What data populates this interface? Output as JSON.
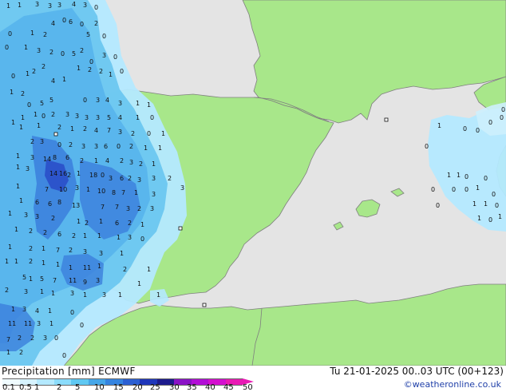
{
  "header": {
    "product": "Precipitation [mm]",
    "model": "ECMWF",
    "datetime": "Tu 21-01-2025 00..03 UTC (00+123)",
    "credit": "©weatheronline.co.uk"
  },
  "legend": {
    "ticks": [
      "0.1",
      "0.5",
      "1",
      "2",
      "5",
      "10",
      "15",
      "20",
      "25",
      "30",
      "35",
      "40",
      "45",
      "50"
    ],
    "colors": [
      "#f0fbff",
      "#d6f3ff",
      "#b4e9ff",
      "#8bdcfb",
      "#5fc8f2",
      "#45a6e8",
      "#3584e0",
      "#2b5fd3",
      "#1f36ba",
      "#1c1a8c",
      "#8a12c6",
      "#b20ed6",
      "#d40fcf",
      "#e91ab4"
    ]
  },
  "colors": {
    "sea": "#e4e4e4",
    "land": "#a8e78a",
    "border": "#7f7f7f",
    "precip_light": "#b4e9ff",
    "precip_mid": "#6cc7f0",
    "precip_heavy": "#3b7fdc",
    "precip_core": "#2a4fc9"
  },
  "map": {
    "labels": [
      [
        "1",
        8,
        10
      ],
      [
        "1",
        22,
        9
      ],
      [
        "3",
        44,
        8
      ],
      [
        "3",
        60,
        10
      ],
      [
        "3",
        72,
        9
      ],
      [
        "4",
        90,
        8
      ],
      [
        "3",
        104,
        9
      ],
      [
        "0",
        118,
        12
      ],
      [
        "0",
        10,
        45
      ],
      [
        "1",
        38,
        44
      ],
      [
        "2",
        54,
        46
      ],
      [
        "4",
        64,
        32
      ],
      [
        "0",
        78,
        28
      ],
      [
        "6",
        86,
        30
      ],
      [
        "0",
        100,
        33
      ],
      [
        "5",
        108,
        46
      ],
      [
        "2",
        118,
        32
      ],
      [
        "0",
        128,
        48
      ],
      [
        "0",
        6,
        62
      ],
      [
        "1",
        30,
        62
      ],
      [
        "3",
        46,
        66
      ],
      [
        "2",
        62,
        68
      ],
      [
        "0",
        76,
        70
      ],
      [
        "5",
        90,
        70
      ],
      [
        "2",
        100,
        66
      ],
      [
        "0",
        112,
        80
      ],
      [
        "3",
        128,
        72
      ],
      [
        "0",
        142,
        74
      ],
      [
        "0",
        14,
        98
      ],
      [
        "1",
        32,
        95
      ],
      [
        "2",
        40,
        92
      ],
      [
        "2",
        52,
        86
      ],
      [
        "4",
        64,
        104
      ],
      [
        "1",
        78,
        102
      ],
      [
        "1",
        96,
        88
      ],
      [
        "2",
        110,
        90
      ],
      [
        "2",
        124,
        92
      ],
      [
        "1",
        136,
        96
      ],
      [
        "0",
        150,
        92
      ],
      [
        "1",
        12,
        118
      ],
      [
        "2",
        26,
        120
      ],
      [
        "0",
        34,
        134
      ],
      [
        "5",
        50,
        132
      ],
      [
        "5",
        62,
        128
      ],
      [
        "0",
        104,
        128
      ],
      [
        "3",
        120,
        128
      ],
      [
        "4",
        132,
        128
      ],
      [
        "3",
        148,
        132
      ],
      [
        "1",
        170,
        132
      ],
      [
        "1",
        184,
        134
      ],
      [
        "1",
        14,
        156
      ],
      [
        "1",
        26,
        150
      ],
      [
        "1",
        42,
        146
      ],
      [
        "0",
        52,
        148
      ],
      [
        "2",
        64,
        146
      ],
      [
        "3",
        82,
        146
      ],
      [
        "3",
        94,
        148
      ],
      [
        "3",
        106,
        150
      ],
      [
        "3",
        120,
        150
      ],
      [
        "5",
        134,
        150
      ],
      [
        "4",
        148,
        150
      ],
      [
        "1",
        170,
        150
      ],
      [
        "0",
        188,
        150
      ],
      [
        "1",
        24,
        162
      ],
      [
        "1",
        46,
        160
      ],
      [
        "2",
        72,
        162
      ],
      [
        "1",
        88,
        164
      ],
      [
        "2",
        104,
        164
      ],
      [
        "4",
        118,
        166
      ],
      [
        "7",
        134,
        166
      ],
      [
        "3",
        148,
        168
      ],
      [
        "2",
        164,
        170
      ],
      [
        "0",
        184,
        170
      ],
      [
        "1",
        202,
        170
      ],
      [
        "2",
        38,
        180
      ],
      [
        "3",
        50,
        180
      ],
      [
        "0",
        72,
        184
      ],
      [
        "2",
        86,
        184
      ],
      [
        "3",
        102,
        186
      ],
      [
        "3",
        118,
        186
      ],
      [
        "6",
        130,
        186
      ],
      [
        "0",
        146,
        186
      ],
      [
        "2",
        162,
        186
      ],
      [
        "1",
        180,
        188
      ],
      [
        "1",
        198,
        188
      ],
      [
        "1",
        20,
        198
      ],
      [
        "3",
        38,
        200
      ],
      [
        "14",
        54,
        202
      ],
      [
        "8",
        66,
        200
      ],
      [
        "6",
        82,
        200
      ],
      [
        "2",
        100,
        204
      ],
      [
        "1",
        118,
        204
      ],
      [
        "4",
        132,
        204
      ],
      [
        "2",
        150,
        204
      ],
      [
        "3",
        162,
        206
      ],
      [
        "2",
        174,
        208
      ],
      [
        "1",
        190,
        208
      ],
      [
        "1",
        20,
        212
      ],
      [
        "3",
        32,
        214
      ],
      [
        "14",
        62,
        220
      ],
      [
        "16",
        74,
        220
      ],
      [
        "2",
        84,
        222
      ],
      [
        "1",
        96,
        220
      ],
      [
        "18",
        112,
        222
      ],
      [
        "0",
        126,
        222
      ],
      [
        "3",
        136,
        226
      ],
      [
        "6",
        150,
        226
      ],
      [
        "2",
        160,
        226
      ],
      [
        "3",
        172,
        228
      ],
      [
        "3",
        190,
        226
      ],
      [
        "2",
        210,
        226
      ],
      [
        "1",
        20,
        236
      ],
      [
        "7",
        56,
        240
      ],
      [
        "10",
        74,
        240
      ],
      [
        "3",
        94,
        238
      ],
      [
        "1",
        108,
        240
      ],
      [
        "10",
        122,
        242
      ],
      [
        "8",
        140,
        244
      ],
      [
        "7",
        152,
        244
      ],
      [
        "1",
        168,
        244
      ],
      [
        "3",
        190,
        246
      ],
      [
        "3",
        226,
        238
      ],
      [
        "1",
        24,
        254
      ],
      [
        "6",
        44,
        256
      ],
      [
        "6",
        60,
        258
      ],
      [
        "8",
        72,
        256
      ],
      [
        "13",
        90,
        260
      ],
      [
        "7",
        126,
        262
      ],
      [
        "7",
        144,
        262
      ],
      [
        "3",
        158,
        264
      ],
      [
        "2",
        172,
        264
      ],
      [
        "3",
        188,
        264
      ],
      [
        "1",
        10,
        270
      ],
      [
        "3",
        30,
        272
      ],
      [
        "3",
        44,
        274
      ],
      [
        "2",
        64,
        276
      ],
      [
        "1",
        96,
        280
      ],
      [
        "2",
        106,
        282
      ],
      [
        "1",
        124,
        280
      ],
      [
        "6",
        144,
        282
      ],
      [
        "2",
        160,
        282
      ],
      [
        "1",
        176,
        284
      ],
      [
        "1",
        18,
        290
      ],
      [
        "2",
        36,
        292
      ],
      [
        "2",
        54,
        294
      ],
      [
        "6",
        72,
        296
      ],
      [
        "2",
        90,
        298
      ],
      [
        "1",
        104,
        298
      ],
      [
        "1",
        122,
        298
      ],
      [
        "1",
        146,
        300
      ],
      [
        "3",
        160,
        300
      ],
      [
        "0",
        176,
        302
      ],
      [
        "1",
        10,
        312
      ],
      [
        "2",
        36,
        314
      ],
      [
        "1",
        52,
        314
      ],
      [
        "7",
        70,
        316
      ],
      [
        "2",
        86,
        316
      ],
      [
        "3",
        104,
        318
      ],
      [
        "3",
        124,
        320
      ],
      [
        "1",
        150,
        320
      ],
      [
        "1",
        6,
        330
      ],
      [
        "1",
        18,
        330
      ],
      [
        "2",
        36,
        330
      ],
      [
        "1",
        52,
        332
      ],
      [
        "1",
        70,
        334
      ],
      [
        "1",
        86,
        338
      ],
      [
        "11",
        104,
        338
      ],
      [
        "1",
        122,
        336
      ],
      [
        "2",
        154,
        340
      ],
      [
        "1",
        184,
        340
      ],
      [
        "5",
        28,
        350
      ],
      [
        "1",
        36,
        352
      ],
      [
        "5",
        50,
        352
      ],
      [
        "7",
        66,
        354
      ],
      [
        "11",
        86,
        354
      ],
      [
        "9",
        104,
        356
      ],
      [
        "3",
        120,
        354
      ],
      [
        "1",
        172,
        358
      ],
      [
        "2",
        6,
        366
      ],
      [
        "3",
        30,
        368
      ],
      [
        "1",
        50,
        368
      ],
      [
        "1",
        64,
        370
      ],
      [
        "3",
        88,
        370
      ],
      [
        "1",
        104,
        372
      ],
      [
        "3",
        128,
        372
      ],
      [
        "1",
        148,
        372
      ],
      [
        "1",
        196,
        372
      ],
      [
        "1",
        14,
        390
      ],
      [
        "3",
        28,
        390
      ],
      [
        "4",
        44,
        392
      ],
      [
        "1",
        60,
        392
      ],
      [
        "0",
        88,
        394
      ],
      [
        "11",
        10,
        408
      ],
      [
        "11",
        30,
        408
      ],
      [
        "3",
        46,
        408
      ],
      [
        "1",
        62,
        408
      ],
      [
        "0",
        100,
        410
      ],
      [
        "7",
        8,
        428
      ],
      [
        "2",
        22,
        426
      ],
      [
        "2",
        38,
        426
      ],
      [
        "3",
        54,
        426
      ],
      [
        "0",
        68,
        426
      ],
      [
        "1",
        8,
        444
      ],
      [
        "2",
        24,
        444
      ],
      [
        "0",
        78,
        448
      ],
      [
        "1",
        548,
        160
      ],
      [
        "0",
        580,
        164
      ],
      [
        "0",
        596,
        166
      ],
      [
        "0",
        612,
        156
      ],
      [
        "0",
        626,
        150
      ],
      [
        "0",
        628,
        140
      ],
      [
        "0",
        532,
        186
      ],
      [
        "1",
        560,
        222
      ],
      [
        "1",
        572,
        222
      ],
      [
        "0",
        582,
        224
      ],
      [
        "0",
        606,
        226
      ],
      [
        "0",
        540,
        240
      ],
      [
        "0",
        566,
        240
      ],
      [
        "0",
        582,
        240
      ],
      [
        "1",
        596,
        238
      ],
      [
        "0",
        616,
        246
      ],
      [
        "1",
        592,
        258
      ],
      [
        "1",
        606,
        258
      ],
      [
        "0",
        620,
        260
      ],
      [
        "1",
        624,
        274
      ],
      [
        "1",
        598,
        276
      ],
      [
        "0",
        612,
        278
      ],
      [
        "0",
        546,
        260
      ]
    ],
    "markers": [
      [
        484,
        150
      ],
      [
        256,
        382
      ],
      [
        226,
        286
      ],
      [
        70,
        168
      ]
    ]
  }
}
